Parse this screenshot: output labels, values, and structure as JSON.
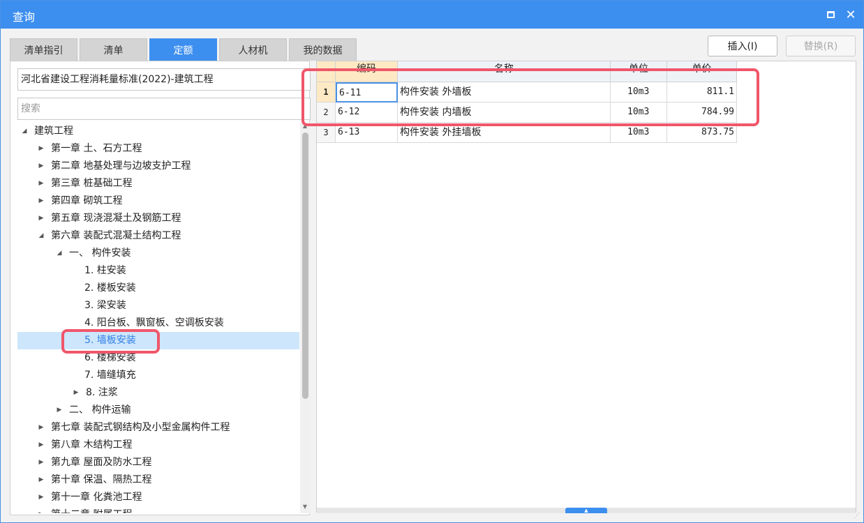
{
  "window": {
    "title": "查询",
    "maximize_icon": "maximize-icon",
    "close_glyph": "✕",
    "accent_color": "#3d8fef",
    "highlight_color": "#f0566a"
  },
  "tabs": [
    {
      "label": "清单指引",
      "active": false
    },
    {
      "label": "清单",
      "active": false
    },
    {
      "label": "定额",
      "active": true
    },
    {
      "label": "人材机",
      "active": false
    },
    {
      "label": "我的数据",
      "active": false
    }
  ],
  "actions": {
    "insert_label": "插入(I)",
    "replace_label": "替换(R)",
    "replace_disabled": true
  },
  "standard": {
    "value": "河北省建设工程消耗量标准(2022)-建筑工程"
  },
  "search": {
    "placeholder": "搜索",
    "value": ""
  },
  "tree": [
    {
      "label": "建筑工程",
      "level": 0,
      "state": "expanded",
      "selected": false
    },
    {
      "label": "第一章 土、石方工程",
      "level": 1,
      "state": "collapsed",
      "selected": false
    },
    {
      "label": "第二章 地基处理与边坡支护工程",
      "level": 1,
      "state": "collapsed",
      "selected": false
    },
    {
      "label": "第三章 桩基础工程",
      "level": 1,
      "state": "collapsed",
      "selected": false
    },
    {
      "label": "第四章 砌筑工程",
      "level": 1,
      "state": "collapsed",
      "selected": false
    },
    {
      "label": "第五章 现浇混凝土及钢筋工程",
      "level": 1,
      "state": "collapsed",
      "selected": false
    },
    {
      "label": "第六章 装配式混凝土结构工程",
      "level": 1,
      "state": "expanded",
      "selected": false
    },
    {
      "label": "一、 构件安装",
      "level": 2,
      "state": "expanded",
      "selected": false
    },
    {
      "label": "1. 柱安装",
      "level": 3,
      "state": "leaf",
      "selected": false
    },
    {
      "label": "2. 楼板安装",
      "level": 3,
      "state": "leaf",
      "selected": false
    },
    {
      "label": "3. 梁安装",
      "level": 3,
      "state": "leaf",
      "selected": false
    },
    {
      "label": "4. 阳台板、飘窗板、空调板安装",
      "level": 3,
      "state": "leaf",
      "selected": false
    },
    {
      "label": "5. 墙板安装",
      "level": 3,
      "state": "leaf",
      "selected": true
    },
    {
      "label": "6. 楼梯安装",
      "level": 3,
      "state": "leaf",
      "selected": false
    },
    {
      "label": "7. 墙缝填充",
      "level": 3,
      "state": "leaf",
      "selected": false
    },
    {
      "label": "8. 注浆",
      "level": 3,
      "state": "collapsed",
      "selected": false
    },
    {
      "label": "二、 构件运输",
      "level": 2,
      "state": "collapsed",
      "selected": false
    },
    {
      "label": "第七章 装配式钢结构及小型金属构件工程",
      "level": 1,
      "state": "collapsed",
      "selected": false
    },
    {
      "label": "第八章 木结构工程",
      "level": 1,
      "state": "collapsed",
      "selected": false
    },
    {
      "label": "第九章 屋面及防水工程",
      "level": 1,
      "state": "collapsed",
      "selected": false
    },
    {
      "label": "第十章 保温、隔热工程",
      "level": 1,
      "state": "collapsed",
      "selected": false
    },
    {
      "label": "第十一章 化粪池工程",
      "level": 1,
      "state": "collapsed",
      "selected": false
    },
    {
      "label": "第十二章 附属工程",
      "level": 1,
      "state": "collapsed",
      "selected": false
    }
  ],
  "grid": {
    "columns": [
      "编码",
      "名称",
      "单位",
      "单价"
    ],
    "rows": [
      {
        "num": "1",
        "code": "6-11",
        "name": "构件安装 外墙板",
        "unit": "10m3",
        "price": "811.1"
      },
      {
        "num": "2",
        "code": "6-12",
        "name": "构件安装 内墙板",
        "unit": "10m3",
        "price": "784.99"
      },
      {
        "num": "3",
        "code": "6-13",
        "name": "构件安装 外挂墙板",
        "unit": "10m3",
        "price": "873.75"
      }
    ],
    "active_row": 0
  }
}
